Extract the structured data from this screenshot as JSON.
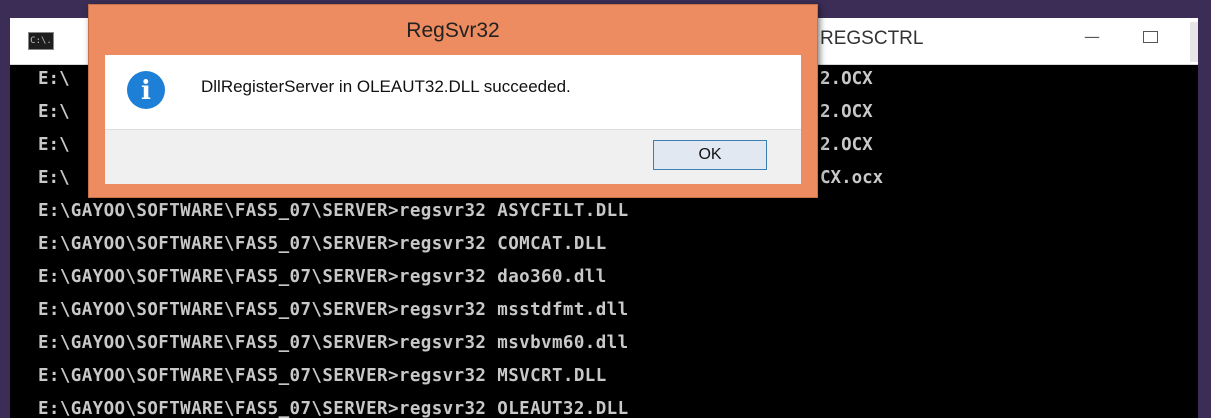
{
  "console": {
    "title": "REGSCTRL",
    "minimize_glyph": "—",
    "icon_label": "C:\\.",
    "lines": [
      "E:\\GAYOO\\SOFTWARE\\FAS5_07\\SERVER>regsvr32 ASYCFILT.DLL",
      "E:\\GAYOO\\SOFTWARE\\FAS5_07\\SERVER>regsvr32 COMCAT.DLL",
      "E:\\GAYOO\\SOFTWARE\\FAS5_07\\SERVER>regsvr32 dao360.dll",
      "E:\\GAYOO\\SOFTWARE\\FAS5_07\\SERVER>regsvr32 msstdfmt.dll",
      "E:\\GAYOO\\SOFTWARE\\FAS5_07\\SERVER>regsvr32 msvbvm60.dll",
      "E:\\GAYOO\\SOFTWARE\\FAS5_07\\SERVER>regsvr32 MSVCRT.DLL",
      "E:\\GAYOO\\SOFTWARE\\FAS5_07\\SERVER>regsvr32 OLEAUT32.DLL"
    ],
    "partial_lines": [
      {
        "left": "E:\\",
        "right": "2.OCX"
      },
      {
        "left": "E:\\",
        "right": "2.OCX"
      },
      {
        "left": "E:\\",
        "right": "2.OCX"
      },
      {
        "left": "E:\\",
        "right": "CX.ocx"
      }
    ]
  },
  "dialog": {
    "title": "RegSvr32",
    "icon": "info-icon",
    "message": "DllRegisterServer in OLEAUT32.DLL succeeded.",
    "ok_label": "OK",
    "accent_color": "#ec8c60"
  }
}
